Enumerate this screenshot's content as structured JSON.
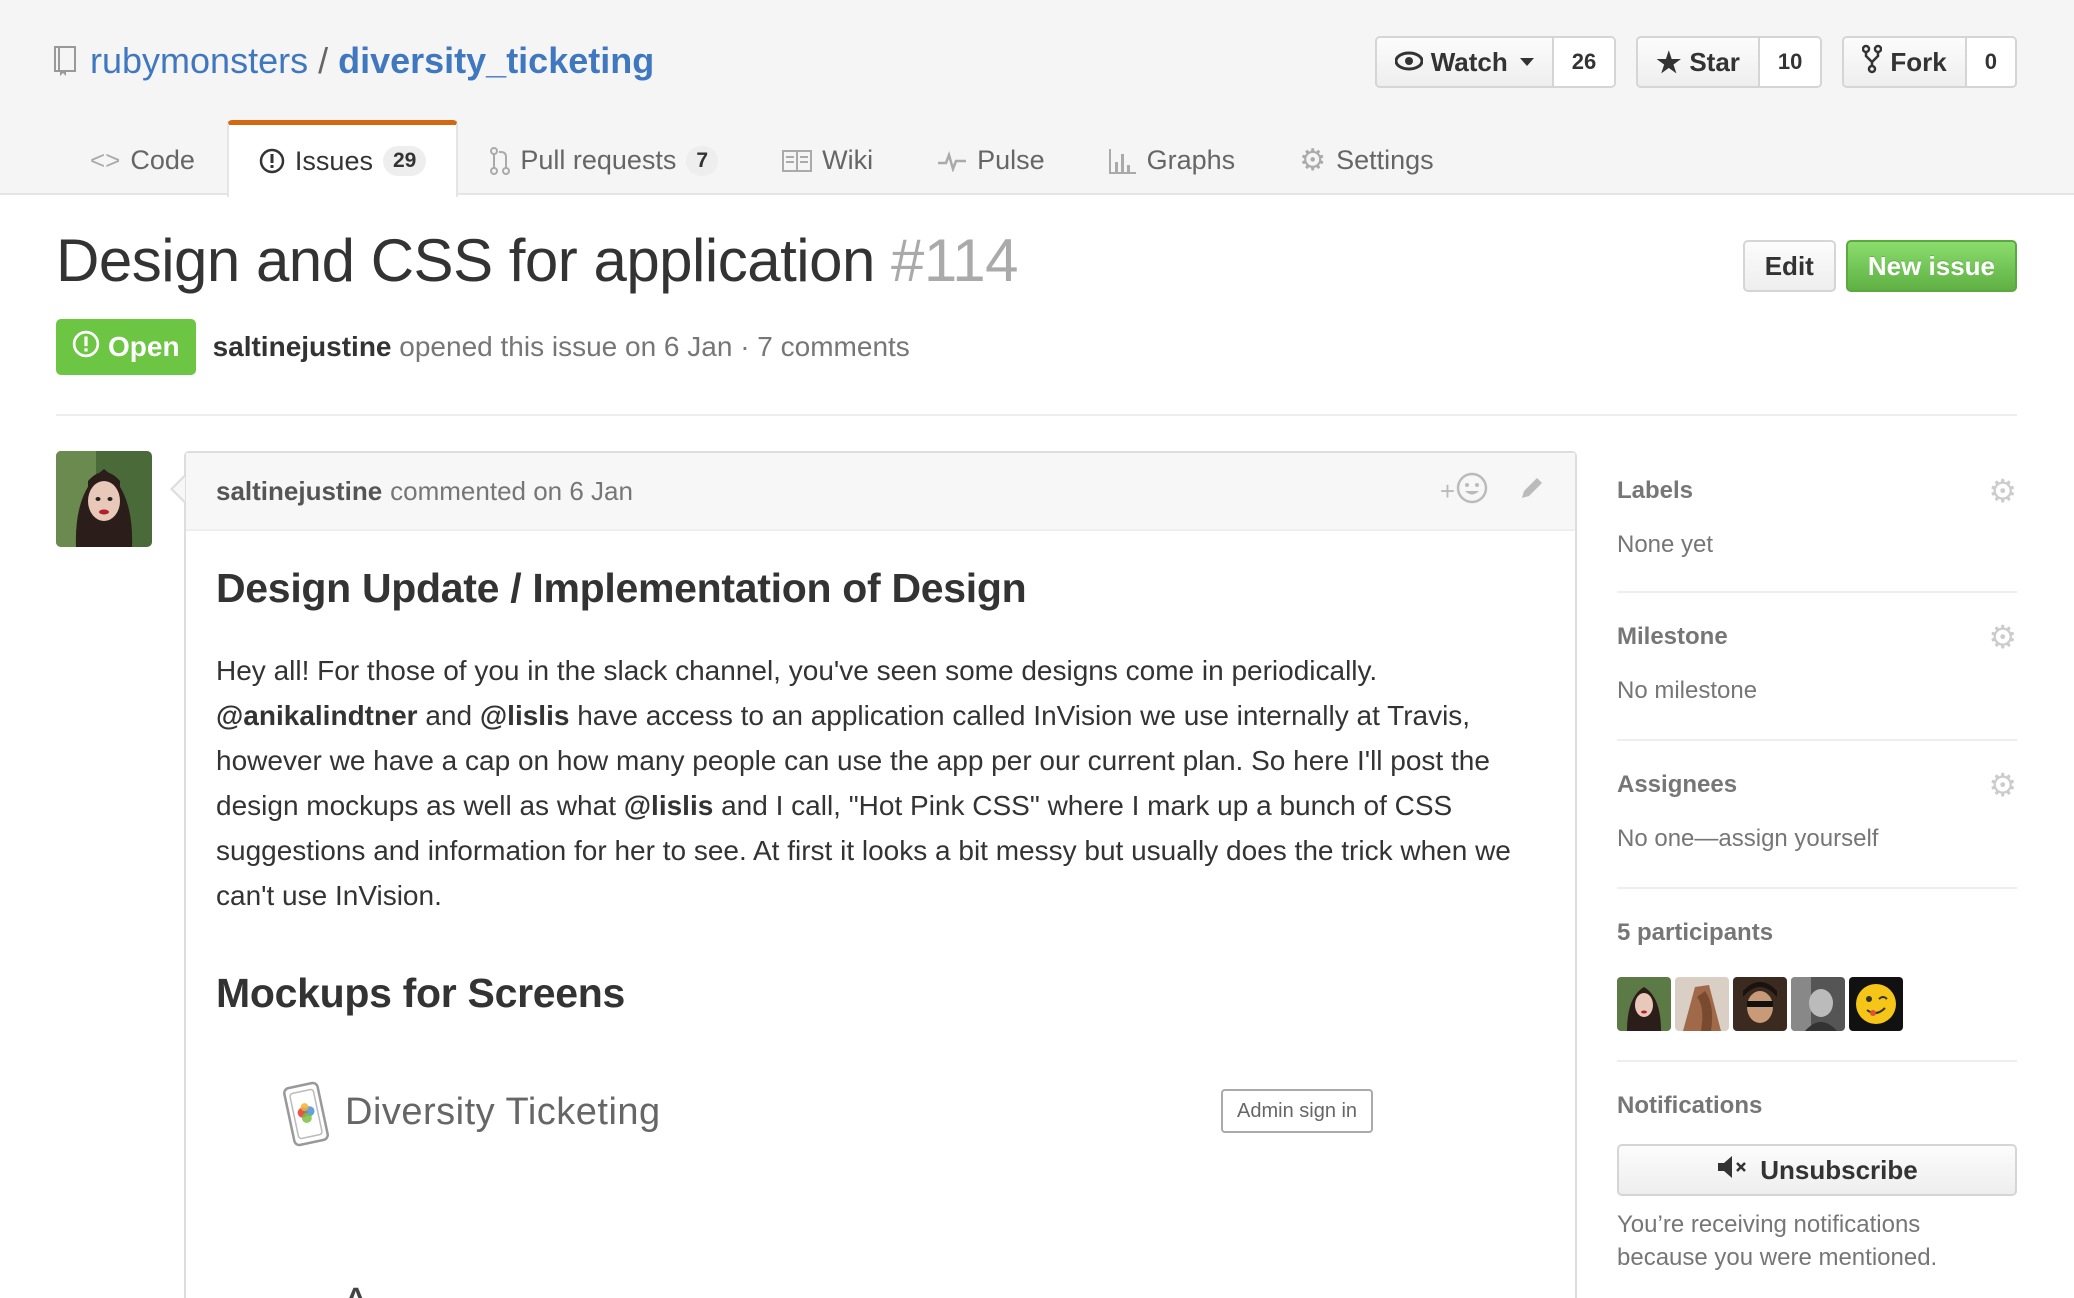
{
  "repo": {
    "owner": "rubymonsters",
    "separator": "/",
    "name": "diversity_ticketing"
  },
  "actions": {
    "watch_label": "Watch",
    "watch_count": "26",
    "star_label": "Star",
    "star_count": "10",
    "fork_label": "Fork",
    "fork_count": "0"
  },
  "nav": {
    "code": "Code",
    "issues": "Issues",
    "issues_count": "29",
    "pulls": "Pull requests",
    "pulls_count": "7",
    "wiki": "Wiki",
    "pulse": "Pulse",
    "graphs": "Graphs",
    "settings": "Settings"
  },
  "issue": {
    "title": "Design and CSS for application",
    "number": "#114",
    "edit_label": "Edit",
    "new_issue_label": "New issue",
    "state": "Open",
    "author": "saltinejustine",
    "opened_text": "opened this issue on 6 Jan · 7 comments"
  },
  "comment": {
    "author": "saltinejustine",
    "commented_text": "commented on 6 Jan",
    "reaction_plus": "+",
    "heading1": "Design Update / Implementation of Design",
    "p_1": "Hey all! For those of you in the slack channel, you've seen some designs come in periodically.",
    "mention1": "@anikalindtner",
    "p_2": " and ",
    "mention2": "@lislis",
    "p_3": " have access to an application called InVision we use internally at Travis, however we have a cap on how many people can use the app per our current plan. So here I'll post the design mockups as well as what ",
    "mention3": "@lislis",
    "p_4": " and I call, \"Hot Pink CSS\" where I mark up a bunch of CSS suggestions and information for her to see. At first it looks a bit messy but usually does the trick when we can't use InVision.",
    "heading2": "Mockups for Screens",
    "mockup_brand": "Diversity Ticketing",
    "mockup_admin": "Admin sign in",
    "mockup_cutoff": "A"
  },
  "sidebar": {
    "labels_title": "Labels",
    "labels_value": "None yet",
    "milestone_title": "Milestone",
    "milestone_value": "No milestone",
    "assignees_title": "Assignees",
    "assignees_value": "No one—assign yourself",
    "participants_title": "5 participants",
    "notifications_title": "Notifications",
    "unsubscribe_label": "Unsubscribe",
    "notif_reason": "You’re receiving notifications because you were mentioned."
  },
  "colors": {
    "link": "#4078c0",
    "open_green": "#6cc644",
    "new_issue_green": "#60b044",
    "selected_tab_accent": "#d26911"
  }
}
